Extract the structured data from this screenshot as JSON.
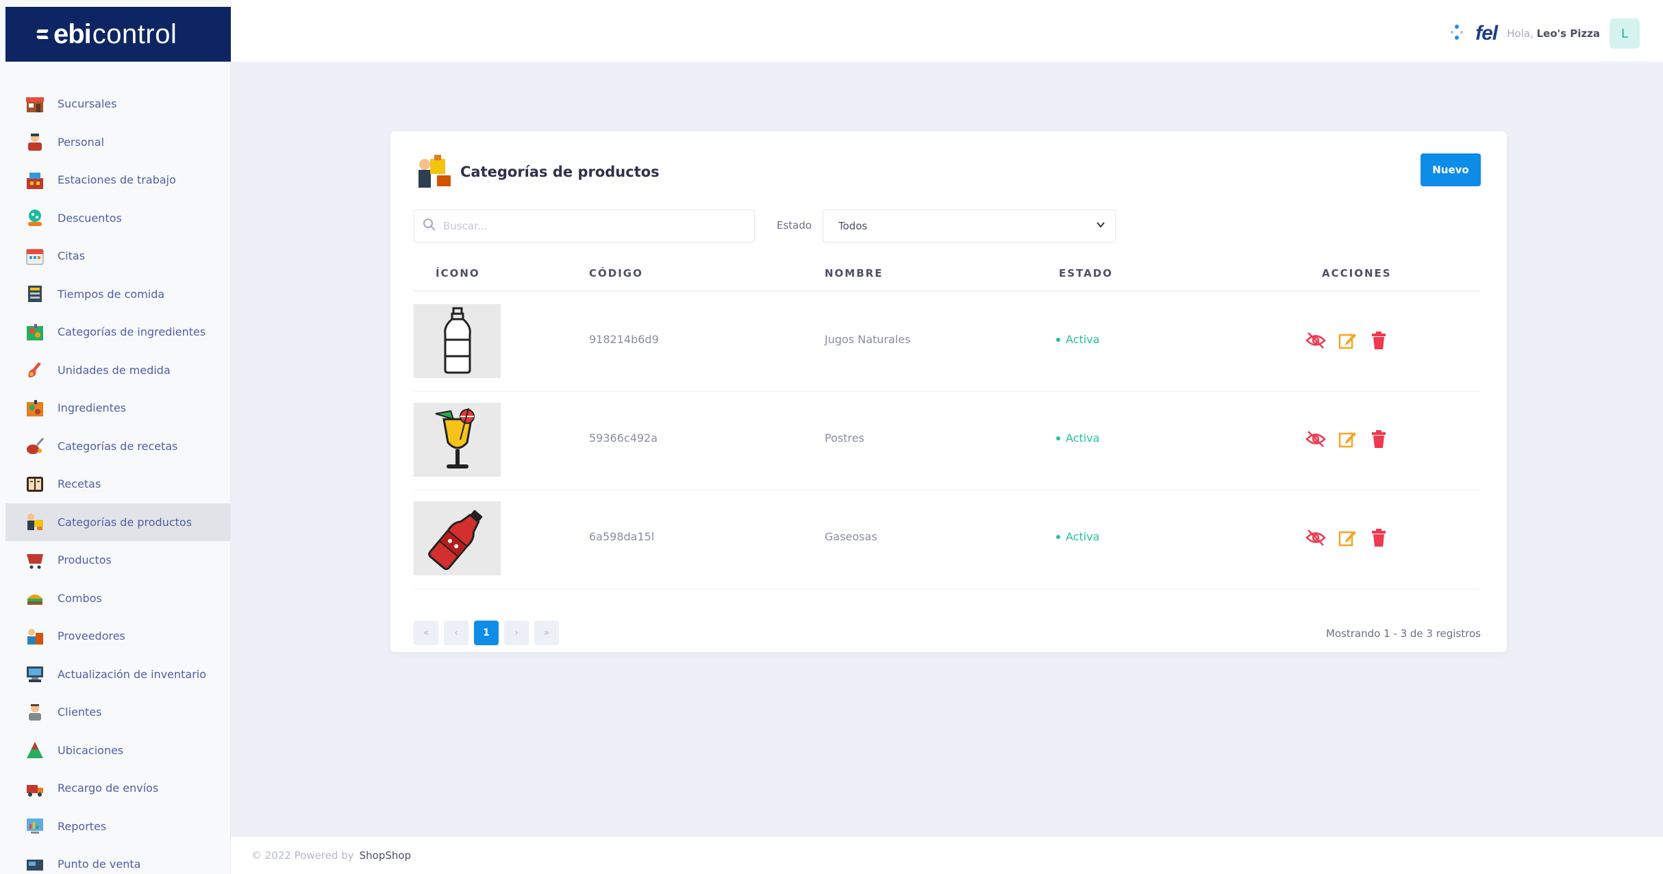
{
  "brand": {
    "part1": "ebi",
    "part2": "control"
  },
  "sidebar": {
    "items": [
      {
        "label": "Sucursales",
        "icon": "store-icon"
      },
      {
        "label": "Personal",
        "icon": "staff-icon"
      },
      {
        "label": "Estaciones de trabajo",
        "icon": "workstation-icon"
      },
      {
        "label": "Descuentos",
        "icon": "discount-icon"
      },
      {
        "label": "Citas",
        "icon": "calendar-icon"
      },
      {
        "label": "Tiempos de comida",
        "icon": "meal-time-icon"
      },
      {
        "label": "Categorías de ingredientes",
        "icon": "ingredient-category-icon"
      },
      {
        "label": "Unidades de medida",
        "icon": "measure-icon"
      },
      {
        "label": "Ingredientes",
        "icon": "ingredients-icon"
      },
      {
        "label": "Categorías de recetas",
        "icon": "recipe-category-icon"
      },
      {
        "label": "Recetas",
        "icon": "recipe-book-icon"
      },
      {
        "label": "Categorías de productos",
        "icon": "product-category-icon",
        "active": true
      },
      {
        "label": "Productos",
        "icon": "products-icon"
      },
      {
        "label": "Combos",
        "icon": "combo-icon"
      },
      {
        "label": "Proveedores",
        "icon": "supplier-icon"
      },
      {
        "label": "Actualización de inventario",
        "icon": "inventory-icon"
      },
      {
        "label": "Clientes",
        "icon": "client-icon"
      },
      {
        "label": "Ubicaciones",
        "icon": "location-icon"
      },
      {
        "label": "Recargo de envíos",
        "icon": "delivery-icon"
      },
      {
        "label": "Reportes",
        "icon": "report-icon"
      },
      {
        "label": "Punto de venta",
        "icon": "pos-icon"
      }
    ]
  },
  "header": {
    "fel_logo": "fel",
    "greeting_prefix": "Hola,",
    "user_name": "Leo's Pizza",
    "avatar_initial": "L"
  },
  "page": {
    "title": "Categorías de productos",
    "new_button": "Nuevo",
    "search_placeholder": "Buscar...",
    "filter_label": "Estado",
    "filter_value": "Todos"
  },
  "table": {
    "columns": [
      "ÍCONO",
      "CÓDIGO",
      "NOMBRE",
      "ESTADO",
      "ACCIONES"
    ],
    "rows": [
      {
        "code": "918214b6d9",
        "name": "Jugos Naturales",
        "status": "Activa",
        "image": "water-bottle-icon"
      },
      {
        "code": "59366c492a",
        "name": "Postres",
        "status": "Activa",
        "image": "cocktail-icon"
      },
      {
        "code": "6a598da15l",
        "name": "Gaseosas",
        "status": "Activa",
        "image": "soda-bottle-icon"
      }
    ]
  },
  "pagination": {
    "first": "«",
    "prev": "‹",
    "current": "1",
    "next": "›",
    "last": "»",
    "summary": "Mostrando 1 - 3 de 3 registros"
  },
  "footer": {
    "text": "© 2022 Powered by",
    "brand": "ShopShop"
  },
  "colors": {
    "brand_navy": "#0d2563",
    "primary_blue": "#0d8ce8",
    "active_green": "#22c39a",
    "action_red": "#f0384f",
    "action_orange": "#f5a623"
  }
}
